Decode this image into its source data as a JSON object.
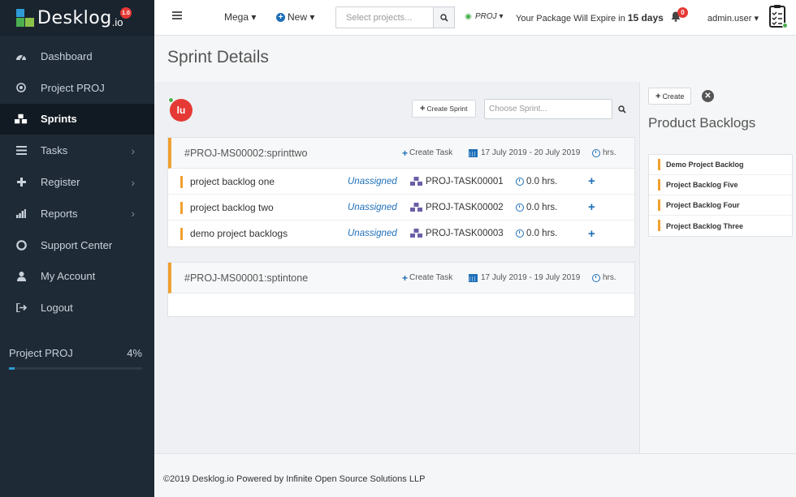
{
  "brand": {
    "name": "Desklog",
    "tld": ".io",
    "version": "1.0"
  },
  "sidebar": {
    "items": [
      {
        "label": "Dashboard",
        "icon": "dashboard-icon",
        "has_submenu": false,
        "active": false
      },
      {
        "label": "Project PROJ",
        "icon": "target-icon",
        "has_submenu": false,
        "active": false
      },
      {
        "label": "Sprints",
        "icon": "cubes-icon",
        "has_submenu": false,
        "active": true
      },
      {
        "label": "Tasks",
        "icon": "list-icon",
        "has_submenu": true,
        "active": false
      },
      {
        "label": "Register",
        "icon": "plus-icon",
        "has_submenu": true,
        "active": false
      },
      {
        "label": "Reports",
        "icon": "bar-chart-icon",
        "has_submenu": true,
        "active": false
      },
      {
        "label": "Support Center",
        "icon": "lifebuoy-icon",
        "has_submenu": false,
        "active": false
      },
      {
        "label": "My Account",
        "icon": "user-icon",
        "has_submenu": false,
        "active": false
      },
      {
        "label": "Logout",
        "icon": "logout-icon",
        "has_submenu": false,
        "active": false
      }
    ],
    "project_progress": {
      "label": "Project PROJ",
      "percent_label": "4%",
      "percent": 4
    }
  },
  "topbar": {
    "mega_label": "Mega",
    "new_label": "New",
    "search_placeholder": "Select projects...",
    "project_label": "PROJ",
    "expire_text": "Your Package Will Expire in",
    "expire_days": "15 days",
    "notification_count": "0",
    "username": "admin.user"
  },
  "page": {
    "title": "Sprint Details"
  },
  "main": {
    "user_initials": "lu",
    "create_sprint_label": "Create Sprint",
    "choose_sprint_placeholder": "Choose Sprint...",
    "sprints": [
      {
        "code": "#PROJ-MS00002:sprinttwo",
        "create_task_label": "Create Task",
        "dates": "17 July 2019 - 20 July 2019",
        "hrs": "hrs.",
        "tasks": [
          {
            "name": "project backlog one",
            "assignee": "Unassigned",
            "task_id": "PROJ-TASK00001",
            "hrs": "0.0 hrs."
          },
          {
            "name": "project backlog two",
            "assignee": "Unassigned",
            "task_id": "PROJ-TASK00002",
            "hrs": "0.0 hrs."
          },
          {
            "name": "demo project backlogs",
            "assignee": "Unassigned",
            "task_id": "PROJ-TASK00003",
            "hrs": "0.0 hrs."
          }
        ]
      },
      {
        "code": "#PROJ-MS00001:sptintone",
        "create_task_label": "Create Task",
        "dates": "17 July 2019 - 19 July 2019",
        "hrs": "hrs.",
        "tasks": []
      }
    ]
  },
  "right_panel": {
    "create_label": "Create",
    "title": "Product Backlogs",
    "backlogs": [
      "Demo Project Backlog",
      "Project Backlog Five",
      "Project Backlog Four",
      "Project Backlog Three"
    ]
  },
  "footer": {
    "text": "©2019 Desklog.io Powered by Infinite Open Source Solutions LLP"
  },
  "colors": {
    "sidebar_bg": "#1e2a36",
    "accent_blue": "#1e6fb8",
    "accent_orange": "#f0a030",
    "badge_red": "#e53935",
    "online_green": "#4caf50"
  }
}
